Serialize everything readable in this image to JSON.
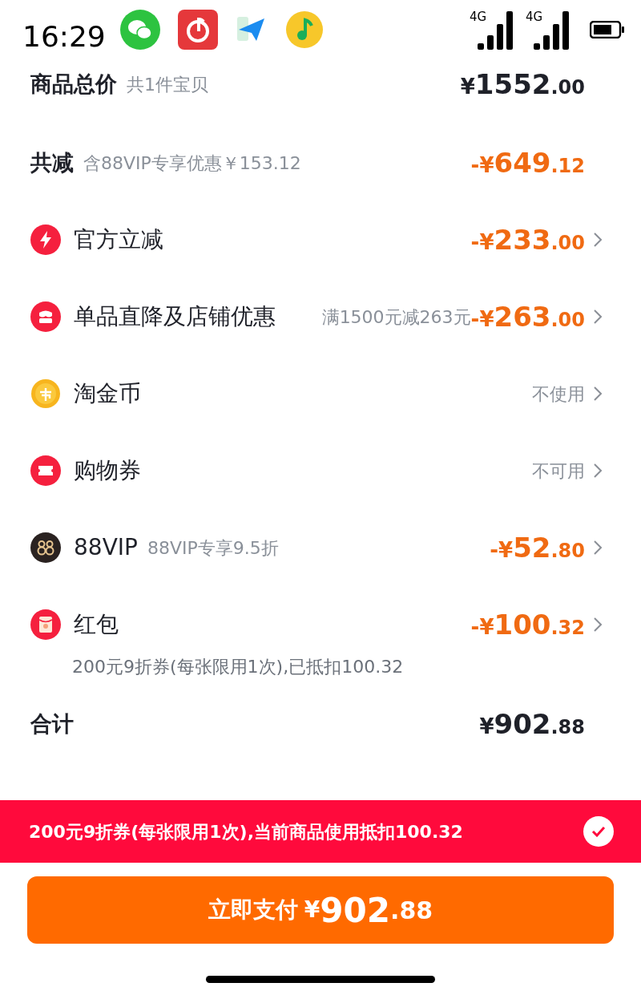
{
  "status_bar": {
    "time": "16:29",
    "signals": [
      {
        "label": "4G"
      },
      {
        "label": "4G"
      }
    ]
  },
  "rows": [
    {
      "kind": "summary",
      "label": "商品总价",
      "sub": "共1件宝贝",
      "amount": {
        "prefix": "¥",
        "integer": "1552",
        "decimal": ".00",
        "color": "#1f2129"
      }
    },
    {
      "kind": "summary",
      "label": "共减",
      "sub": "含88VIP专享优惠￥153.12",
      "amount": {
        "prefix": "-¥",
        "integer": "649",
        "decimal": ".12",
        "color": "#f06a12"
      }
    },
    {
      "kind": "discount",
      "label": "官方立减",
      "amount": {
        "prefix": "-¥",
        "integer": "233",
        "decimal": ".00",
        "color": "#f06a12"
      }
    },
    {
      "kind": "discount",
      "label": "单品直降及店铺优惠",
      "note": "满1500元减263元",
      "amount": {
        "prefix": "-¥",
        "integer": "263",
        "decimal": ".00",
        "color": "#f06a12"
      }
    },
    {
      "kind": "discount",
      "label": "淘金币",
      "value": "不使用"
    },
    {
      "kind": "discount",
      "label": "购物券",
      "value": "不可用"
    },
    {
      "kind": "discount",
      "label": "88VIP",
      "sub": "88VIP专享9.5折",
      "amount": {
        "prefix": "-¥",
        "integer": "52",
        "decimal": ".80",
        "color": "#f06a12"
      }
    },
    {
      "kind": "discount",
      "label": "红包",
      "amount": {
        "prefix": "-¥",
        "integer": "100",
        "decimal": ".32",
        "color": "#f06a12"
      },
      "detail": "200元9折券(每张限用1次),已抵扣100.32"
    },
    {
      "kind": "summary",
      "label": "合计",
      "amount": {
        "prefix": "¥",
        "integer": "902",
        "decimal": ".88",
        "color": "#1f2129"
      }
    }
  ],
  "coupon_banner": {
    "text": "200元9折券(每张限用1次),当前商品使用抵扣100.32",
    "checked": true
  },
  "pay_button": {
    "label": "立即支付",
    "prefix": "¥",
    "integer": "902",
    "decimal": ".88"
  }
}
